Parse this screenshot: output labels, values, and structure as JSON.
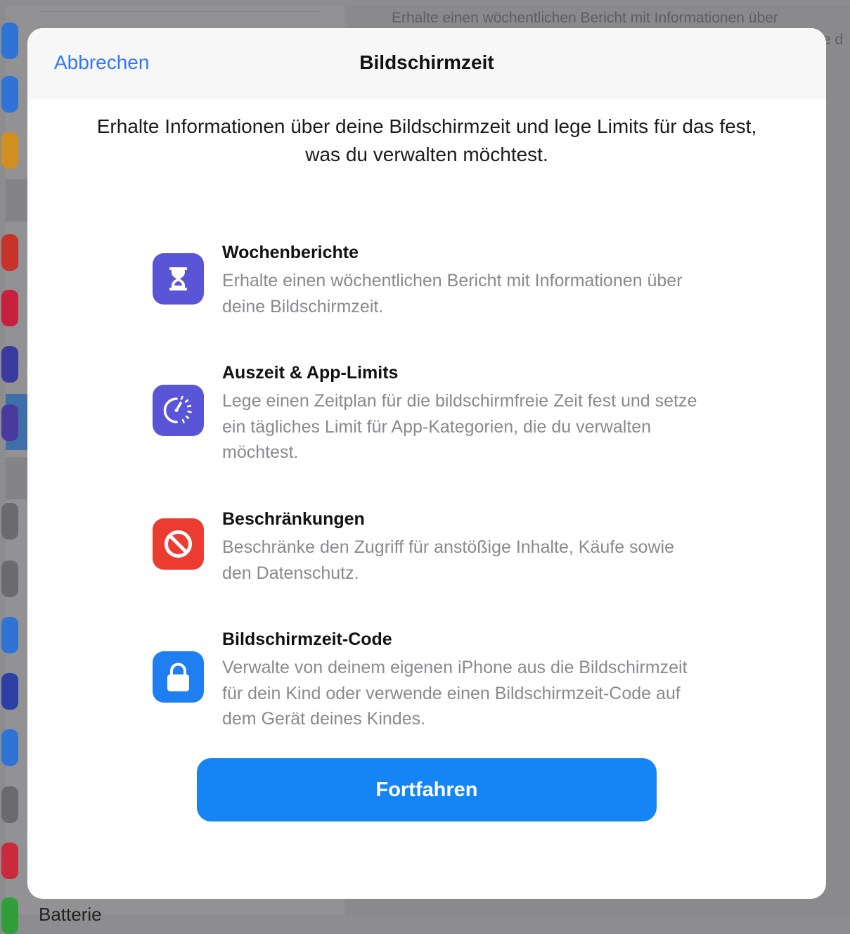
{
  "background": {
    "detail_text_line1": "Erhalte einen wöchentlichen Bericht mit Informationen über",
    "detail_text_line2": "e d",
    "sidebar_bottom_label": "Batterie",
    "app_icon_colors": [
      "#2f73d6",
      "#2f73d6",
      "#d08f1e",
      "#c7322b",
      "#c7203e",
      "#3b3a9e",
      "#4a3a9e",
      "#6b6b6d",
      "#6b6b6d",
      "#2f73d6",
      "#2c3fa6",
      "#2f73d6",
      "#6b6b6d",
      "#c92a3c",
      "#2f9e3b"
    ]
  },
  "sheet": {
    "cancel_label": "Abbrechen",
    "title": "Bildschirmzeit",
    "intro": "Erhalte Informationen über deine Bildschirmzeit und lege Limits für das fest, was du verwalten möchtest.",
    "features": [
      {
        "icon": "hourglass-icon",
        "icon_color": "#5a55d6",
        "title": "Wochenberichte",
        "description": "Erhalte einen wöchentlichen Bericht mit Informationen über deine Bildschirmzeit."
      },
      {
        "icon": "downtime-timer-icon",
        "icon_color": "#5a55d6",
        "title": "Auszeit & App-Limits",
        "description": "Lege einen Zeitplan für die bildschirmfreie Zeit fest und setze ein tägliches Limit für App-Kategorien, die du verwalten möchtest."
      },
      {
        "icon": "restriction-icon",
        "icon_color": "#ec3b30",
        "title": "Beschränkungen",
        "description": "Beschränke den Zugriff für anstößige Inhalte, Käufe sowie den Datenschutz."
      },
      {
        "icon": "lock-icon",
        "icon_color": "#1f7ff0",
        "title": "Bildschirmzeit-Code",
        "description": "Verwalte von deinem eigenen iPhone aus die Bildschirmzeit für dein Kind oder verwende einen Bildschirmzeit-Code auf dem Gerät deines Kindes."
      }
    ],
    "continue_label": "Fortfahren",
    "accent_color": "#1584f5"
  }
}
